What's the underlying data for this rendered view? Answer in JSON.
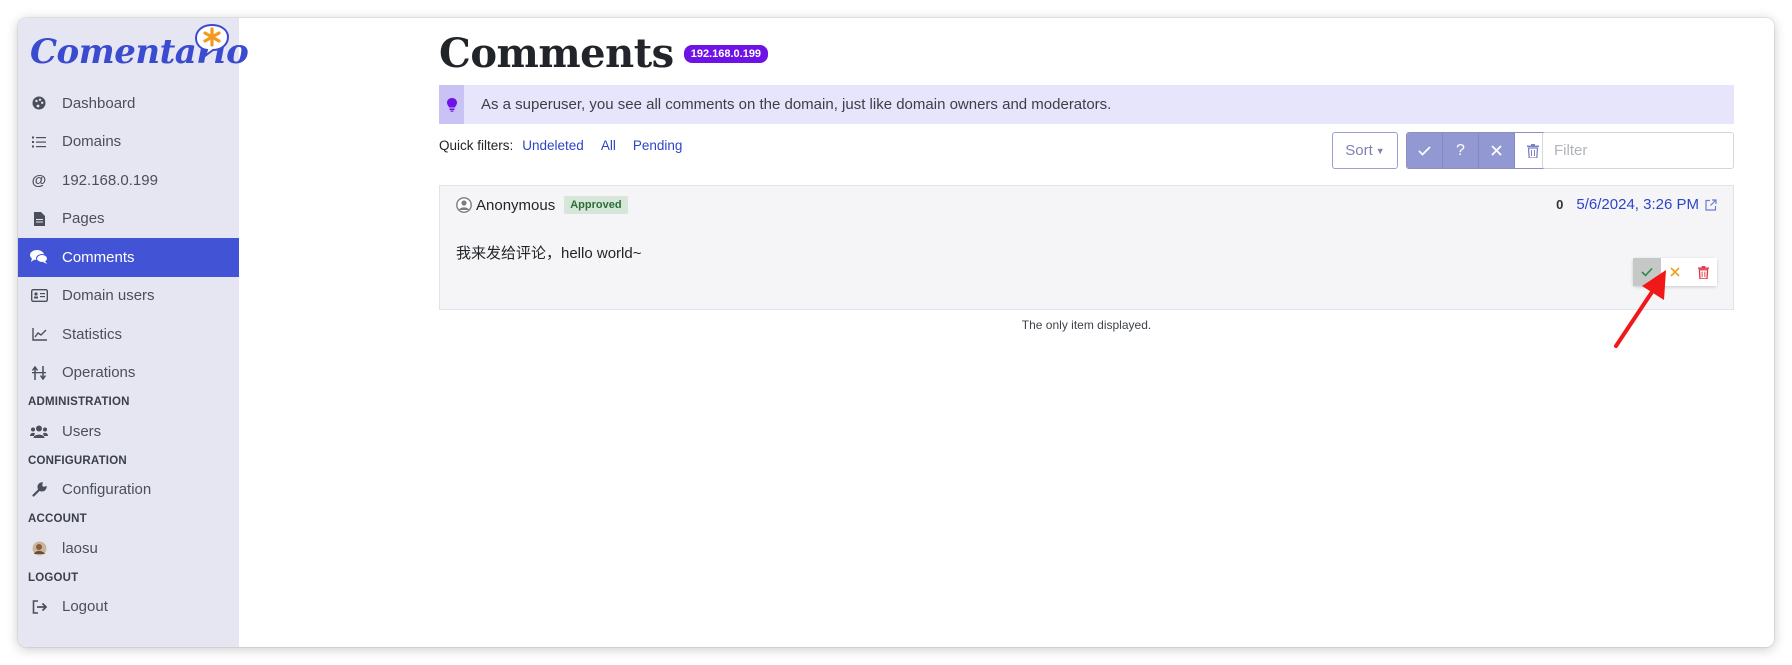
{
  "app": {
    "logo_text": "Comentario",
    "colors": {
      "accent": "#4353d6",
      "sidebar_bg": "#e6e6f3",
      "badge": "#6f12e6",
      "logo_star": "#f39a1e"
    }
  },
  "sidebar": {
    "items": [
      {
        "label": "Dashboard",
        "icon": "palette-icon"
      },
      {
        "label": "Domains",
        "icon": "list-icon"
      },
      {
        "label": "192.168.0.199",
        "icon": "at-icon"
      },
      {
        "label": "Pages",
        "icon": "file-icon"
      },
      {
        "label": "Comments",
        "icon": "comments-icon",
        "active": true
      },
      {
        "label": "Domain users",
        "icon": "id-card-icon"
      },
      {
        "label": "Statistics",
        "icon": "chart-line-icon"
      },
      {
        "label": "Operations",
        "icon": "sliders-icon"
      }
    ],
    "admin_section": "ADMINISTRATION",
    "users_label": "Users",
    "config_section": "CONFIGURATION",
    "config_label": "Configuration",
    "account_section": "ACCOUNT",
    "account_label": "laosu",
    "logout_section": "LOGOUT",
    "logout_label": "Logout"
  },
  "main": {
    "title": "Comments",
    "domain_badge": "192.168.0.199",
    "alert": "As a superuser, you see all comments on the domain, just like domain owners and moderators.",
    "quick_filters_label": "Quick filters:",
    "quick_filters": [
      "Undeleted",
      "All",
      "Pending"
    ],
    "sort_label": "Sort",
    "filter_placeholder": "Filter",
    "comment": {
      "author": "Anonymous",
      "status": "Approved",
      "score": "0",
      "date": "5/6/2024, 3:26 PM",
      "text": "我来发给评论，hello world~"
    },
    "footer_note": "The only item displayed."
  }
}
